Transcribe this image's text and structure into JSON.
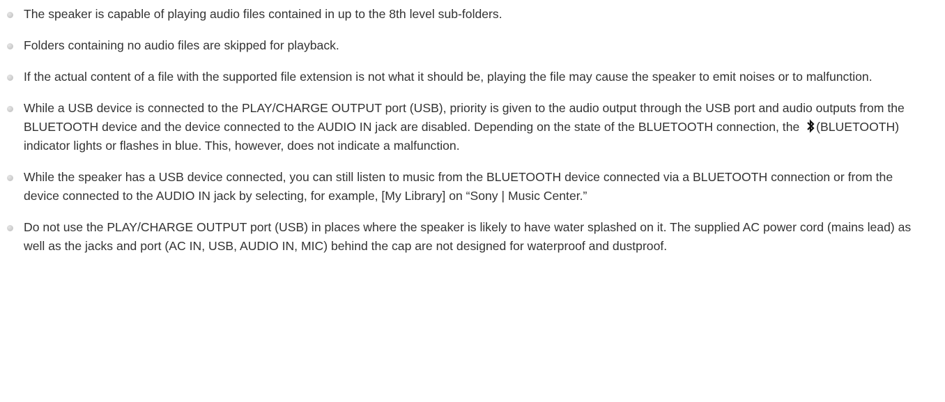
{
  "notes": [
    {
      "text": "The speaker is capable of playing audio files contained in up to the 8th level sub-folders."
    },
    {
      "text": "Folders containing no audio files are skipped for playback."
    },
    {
      "text": "If the actual content of a file with the supported file extension is not what it should be, playing the file may cause the speaker to emit noises or to malfunction."
    },
    {
      "text_before_icon": "While a USB device is connected to the PLAY/CHARGE OUTPUT port (USB), priority is given to the audio output through the USB port and audio outputs from the BLUETOOTH device and the device connected to the AUDIO IN jack are disabled. Depending on the state of the BLUETOOTH connection, the ",
      "icon": "bluetooth-icon",
      "text_after_icon": "(BLUETOOTH) indicator lights or flashes in blue. This, however, does not indicate a malfunction."
    },
    {
      "text": "While the speaker has a USB device connected, you can still listen to music from the BLUETOOTH device connected via a BLUETOOTH connection or from the device connected to the AUDIO IN jack by selecting, for example, [My Library] on “Sony | Music Center.”"
    },
    {
      "text": "Do not use the PLAY/CHARGE OUTPUT port (USB) in places where the speaker is likely to have water splashed on it. The supplied AC power cord (mains lead) as well as the jacks and port (AC IN, USB, AUDIO IN, MIC) behind the cap are not designed for waterproof and dustproof."
    }
  ],
  "colors": {
    "text": "#333333",
    "bullet": "#cfcfcf",
    "background": "#ffffff"
  }
}
